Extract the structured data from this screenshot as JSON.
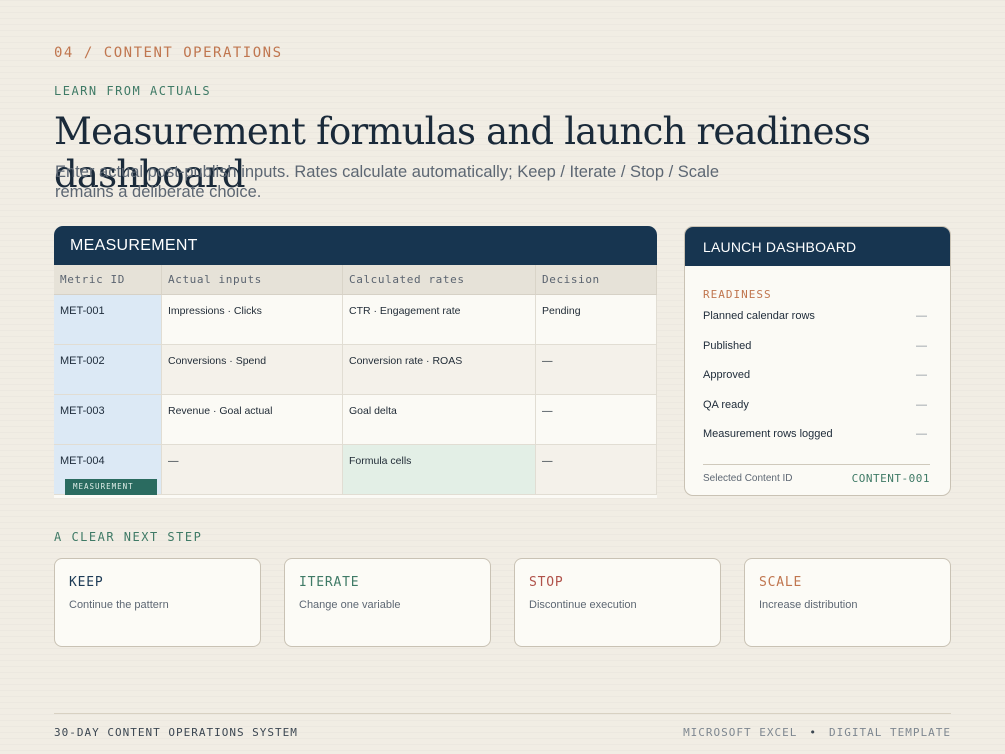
{
  "header": {
    "section_number": "04",
    "separator": "/",
    "section_name": "CONTENT OPERATIONS",
    "kicker": "LEARN FROM ACTUALS",
    "title": "Measurement formulas and launch readiness dashboard",
    "subtitle": "Enter actual post-publish inputs. Rates calculate automatically; Keep / Iterate / Stop / Scale remains a deliberate choice."
  },
  "measurement": {
    "title": "MEASUREMENT",
    "columns": [
      "Metric ID",
      "Actual inputs",
      "Calculated rates",
      "Decision"
    ],
    "rows": [
      {
        "id": "MET-001",
        "inputs": "Impressions · Clicks",
        "rates": "CTR · Engagement rate",
        "decision": "Pending"
      },
      {
        "id": "MET-002",
        "inputs": "Conversions · Spend",
        "rates": "Conversion rate · ROAS",
        "decision": "—"
      },
      {
        "id": "MET-003",
        "inputs": "Revenue · Goal actual",
        "rates": "Goal delta",
        "decision": "—"
      },
      {
        "id": "MET-004",
        "inputs": "—",
        "rates": "Formula cells",
        "decision": "—"
      }
    ],
    "sheet_tag": "MEASUREMENT"
  },
  "dashboard": {
    "title": "LAUNCH DASHBOARD",
    "section": "READINESS",
    "items": [
      {
        "label": "Planned calendar rows",
        "value": "—"
      },
      {
        "label": "Published",
        "value": "—"
      },
      {
        "label": "Approved",
        "value": "—"
      },
      {
        "label": "QA ready",
        "value": "—"
      },
      {
        "label": "Measurement rows logged",
        "value": "—"
      }
    ],
    "selected_label": "Selected Content ID",
    "selected_value": "CONTENT-001"
  },
  "next_step": {
    "label": "A CLEAR NEXT STEP",
    "cards": [
      {
        "title": "KEEP",
        "desc": "Continue the pattern",
        "color": "#1d3b56"
      },
      {
        "title": "ITERATE",
        "desc": "Change one variable",
        "color": "#3f7a66"
      },
      {
        "title": "STOP",
        "desc": "Discontinue execution",
        "color": "#b0524a"
      },
      {
        "title": "SCALE",
        "desc": "Increase distribution",
        "color": "#c0764f"
      }
    ]
  },
  "footer": {
    "left": "30-DAY CONTENT OPERATIONS SYSTEM",
    "right_a": "MICROSOFT EXCEL",
    "right_dot": "•",
    "right_b": "DIGITAL TEMPLATE"
  },
  "colors": {
    "navy": "#173550",
    "accent_orange": "#c0764f",
    "accent_green": "#3f7a66",
    "id_column": "#dce9f5",
    "formula_cell": "#e3efe6"
  }
}
